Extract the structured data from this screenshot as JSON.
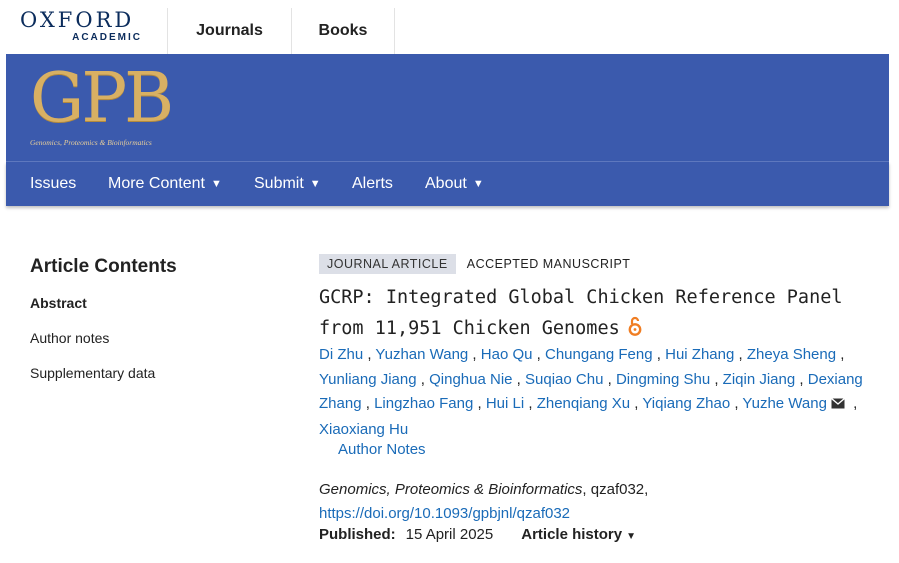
{
  "brand": {
    "name": "OXFORD",
    "sub": "ACADEMIC"
  },
  "top_tabs": [
    {
      "label": "Journals"
    },
    {
      "label": "Books"
    }
  ],
  "journal_logo": {
    "letters": "GPB",
    "tagline": "Genomics, Proteomics & Bioinformatics"
  },
  "colors": {
    "banner": "#3b5aad",
    "logo_gold": "#d8b063",
    "link": "#1a6bb8",
    "open_access": "#f07d22"
  },
  "nav": [
    {
      "label": "Issues",
      "caret": ""
    },
    {
      "label": "More Content",
      "caret": "▼"
    },
    {
      "label": "Submit",
      "caret": "▼"
    },
    {
      "label": "Alerts",
      "caret": ""
    },
    {
      "label": "About",
      "caret": "▼"
    }
  ],
  "sidebar": {
    "title": "Article Contents",
    "items": [
      {
        "label": "Abstract"
      },
      {
        "label": "Author notes"
      },
      {
        "label": "Supplementary data"
      }
    ]
  },
  "article": {
    "type_badge": "JOURNAL ARTICLE",
    "status": "ACCEPTED MANUSCRIPT",
    "title": "GCRP: Integrated Global Chicken Reference Panel from 11,951 Chicken Genomes",
    "open_access_icon": "open-access-lock-icon",
    "authors": [
      "Di Zhu",
      "Yuzhan Wang",
      "Hao Qu",
      "Chungang Feng",
      "Hui Zhang",
      "Zheya Sheng",
      "Yunliang Jiang",
      "Qinghua Nie",
      "Suqiao Chu",
      "Dingming Shu",
      "Ziqin Jiang",
      "Dexiang Zhang",
      "Lingzhao Fang",
      "Hui Li",
      "Zhenqiang Xu",
      "Yiqiang Zhao",
      "Yuzhe Wang",
      "Xiaoxiang Hu"
    ],
    "author_notes_label": "Author Notes",
    "journal": "Genomics, Proteomics & Bioinformatics",
    "article_id": ", qzaf032,",
    "doi": "https://doi.org/10.1093/gpbjnl/qzaf032",
    "published_label": "Published:",
    "published_date": "15 April 2025",
    "history_label": "Article history",
    "history_caret": "▼"
  }
}
